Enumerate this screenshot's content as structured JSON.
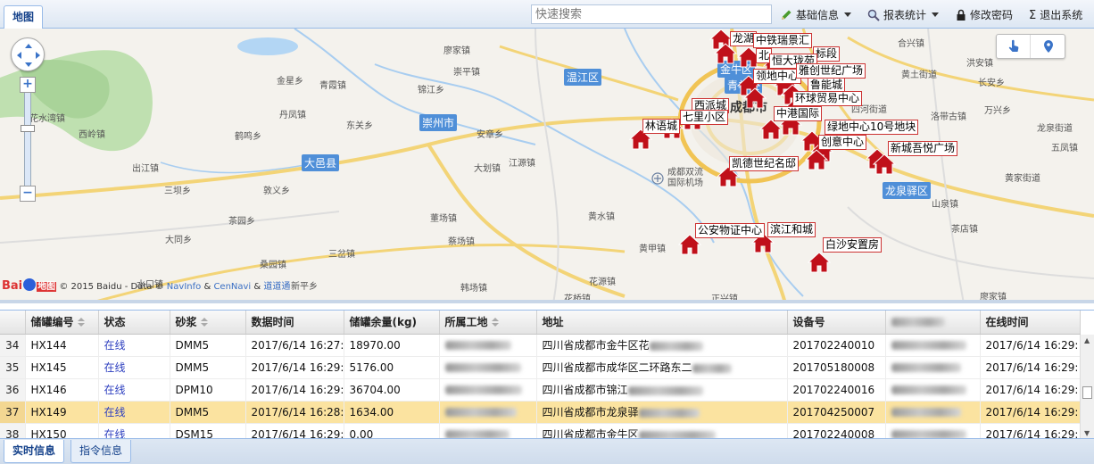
{
  "top": {
    "tab_map": "地图",
    "search_placeholder": "快速搜索",
    "menu_basic": "基础信息",
    "menu_report": "报表统计",
    "menu_password": "修改密码",
    "menu_logout": "退出系统"
  },
  "map": {
    "places": [
      "廖家镇",
      "崇平镇",
      "金星乡",
      "青霞镇",
      "锦江乡",
      "丹凤镇",
      "东关乡",
      "花水湾镇",
      "西岭镇",
      "鹤鸣乡",
      "安章乡",
      "大划镇",
      "出江镇",
      "江源镇",
      "三坝乡",
      "敦义乡",
      "董场镇",
      "黄水镇",
      "茶园乡",
      "蔡场镇",
      "大同乡",
      "桑园镇",
      "三岔镇",
      "新平乡",
      "花源镇",
      "黄甲镇",
      "水口镇",
      "韩场镇",
      "花桥镇",
      "正兴镇",
      "合兴镇",
      "黄土街道",
      "长安乡",
      "洪安镇",
      "洛带古镇",
      "万兴乡",
      "五凤镇",
      "龙泉街道",
      "山泉镇",
      "茶店镇",
      "廖家镇",
      "四河街道",
      "黄家街道"
    ],
    "cities": [
      "温江区",
      "崇州市",
      "大邑县",
      "龙泉驿区",
      "金牛区",
      "青羊区"
    ],
    "main_city": "成都市",
    "airport": "成都双流国际机场",
    "markers": [
      "龙湖",
      "中铁瑞景汇",
      "北",
      "标段",
      "恒大珑苑",
      "领地中心",
      "雅创世纪广场",
      "鲁能城",
      "西派城",
      "环球贸易中心",
      "中港国际",
      "七里小区",
      "林语城",
      "绿地中心10号地块",
      "创意中心",
      "新城吾悦广场",
      "凯德世纪名邸",
      "公安物证中心",
      "滨江和城",
      "白沙安置房"
    ],
    "copyright_brand": "Bai",
    "copyright_brand2": "地图",
    "copyright_text": "© 2015 Baidu - Data ©",
    "copyright_link1": "NavInfo",
    "copyright_amp": "&",
    "copyright_link2": "CenNavi",
    "copyright_amp2": "&",
    "copyright_link3": "道道通",
    "zoom_in": "+",
    "zoom_out": "−"
  },
  "grid": {
    "columns": [
      "储罐编号",
      "状态",
      "砂浆",
      "数据时间",
      "储罐余量(kg)",
      "所属工地",
      "地址",
      "设备号",
      "",
      "在线时间"
    ],
    "rows": [
      {
        "n": "34",
        "id": "HX144",
        "status": "在线",
        "mortar": "DMM5",
        "time": "2017/6/14 16:27:1",
        "amount": "18970.00",
        "addr": "四川省成都市金牛区花",
        "device": "201702240010",
        "online": "2017/6/14 16:29:"
      },
      {
        "n": "35",
        "id": "HX145",
        "status": "在线",
        "mortar": "DMM5",
        "time": "2017/6/14 16:29:0",
        "amount": "5176.00",
        "addr": "四川省成都市成华区二环路东二",
        "device": "201705180008",
        "online": "2017/6/14 16:29:"
      },
      {
        "n": "36",
        "id": "HX146",
        "status": "在线",
        "mortar": "DPM10",
        "time": "2017/6/14 16:29:1",
        "amount": "36704.00",
        "addr": "四川省成都市锦江",
        "device": "201702240016",
        "online": "2017/6/14 16:29:"
      },
      {
        "n": "37",
        "id": "HX149",
        "status": "在线",
        "mortar": "DMM5",
        "time": "2017/6/14 16:28:1",
        "amount": "1634.00",
        "addr": "四川省成都市龙泉驿",
        "device": "201704250007",
        "online": "2017/6/14 16:29:"
      },
      {
        "n": "38",
        "id": "HX150",
        "status": "在线",
        "mortar": "DSM15",
        "time": "2017/6/14 16:29:0",
        "amount": "0.00",
        "addr": "四川省成都市金牛区",
        "device": "201702240008",
        "online": "2017/6/14 16:29:"
      }
    ]
  },
  "bottom": {
    "tab_realtime": "实时信息",
    "tab_command": "指令信息"
  },
  "colors": {
    "accent": "#15428b",
    "marker": "#c0101a",
    "selected_row": "#fbe3a0"
  }
}
